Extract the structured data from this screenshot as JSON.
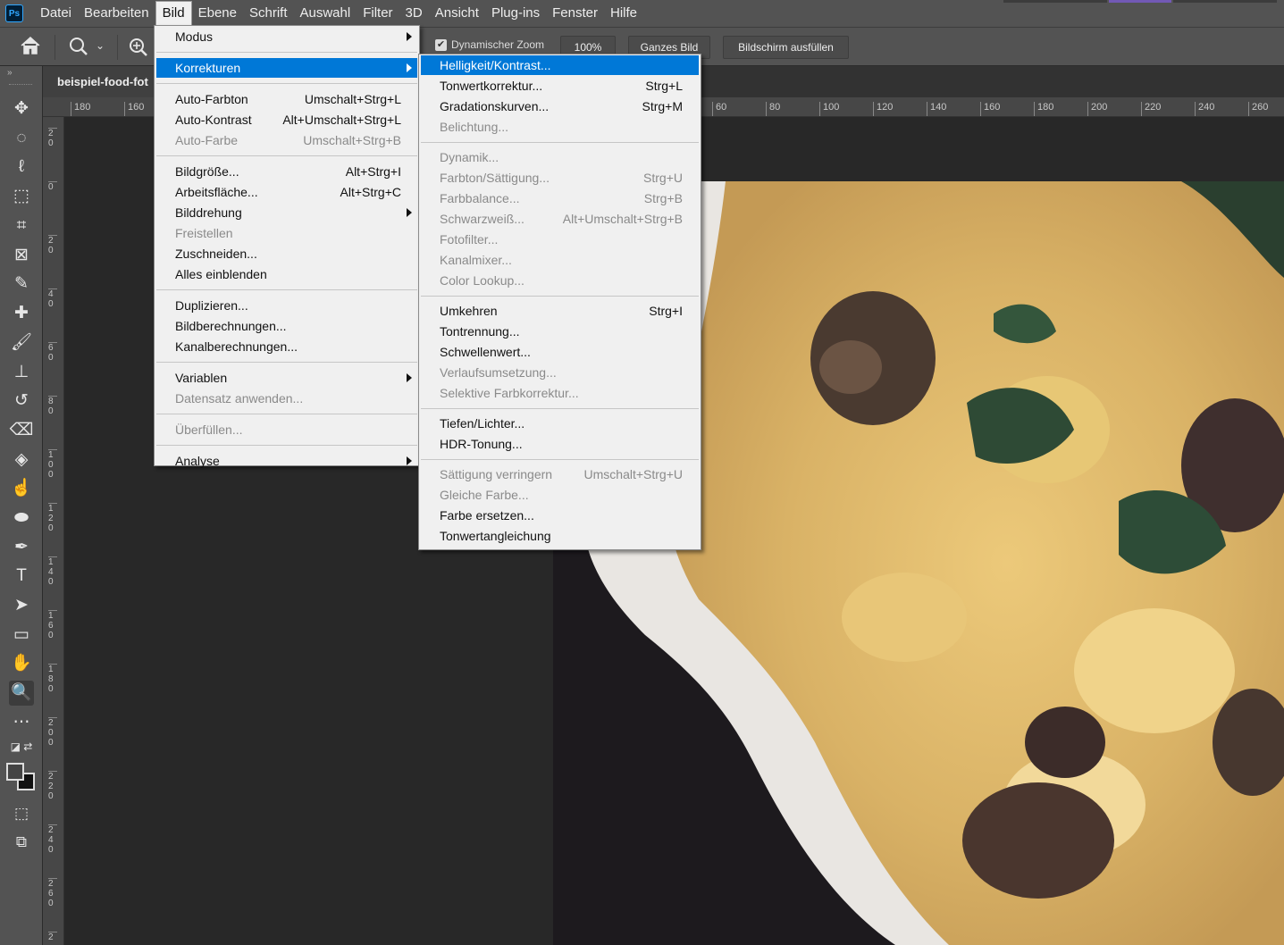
{
  "app": {
    "logo": "Ps",
    "menu": [
      "Datei",
      "Bearbeiten",
      "Bild",
      "Ebene",
      "Schrift",
      "Auswahl",
      "Filter",
      "3D",
      "Ansicht",
      "Plug-ins",
      "Fenster",
      "Hilfe"
    ],
    "active_menu": "Bild"
  },
  "options": {
    "icons": [
      "home-icon",
      "zoom-icon",
      "chevron-down-icon",
      "zoom-in-icon"
    ],
    "checkbox_label": "Dynamischer Zoom",
    "checkbox_checked": true,
    "zoom_value": "100%",
    "fit_button": "Ganzes Bild",
    "fill_button": "Bildschirm ausfüllen"
  },
  "document": {
    "tab_label": "beispiel-food-fot",
    "hruler_ticks": [
      "180",
      "160",
      "60",
      "80",
      "100",
      "120",
      "140",
      "160",
      "180",
      "200",
      "220",
      "240",
      "260"
    ],
    "vruler_ticks": [
      "20",
      "0",
      "20",
      "40",
      "60",
      "80",
      "100",
      "120",
      "140",
      "160",
      "180",
      "200",
      "220",
      "240",
      "260",
      "2"
    ]
  },
  "toolbar": {
    "tools": [
      "move-tool-icon",
      "ellipse-marquee-icon",
      "lasso-icon",
      "object-select-icon",
      "crop-icon",
      "frame-icon",
      "eyedropper-icon",
      "healing-brush-icon",
      "brush-icon",
      "stamp-icon",
      "history-brush-icon",
      "eraser-icon",
      "paint-bucket-icon",
      "smudge-icon",
      "dodge-icon",
      "pen-icon",
      "type-icon",
      "path-select-icon",
      "rectangle-icon",
      "hand-icon",
      "zoom-tool-icon",
      "more-tools-icon"
    ],
    "active_tool": "zoom-tool-icon",
    "glyphs": [
      "✥",
      "◌",
      "ℓ",
      "⬚",
      "⌗",
      "⊠",
      "✎",
      "✚",
      "🖌",
      "⊥",
      "↺",
      "⌫",
      "◈",
      "☝",
      "⬬",
      "✒",
      "T",
      "➤",
      "▭",
      "✋",
      "🔍",
      "⋯"
    ]
  },
  "bild_menu": {
    "groups": [
      [
        {
          "label": "Modus",
          "submenu": true
        }
      ],
      [
        {
          "label": "Korrekturen",
          "submenu": true,
          "highlighted": true
        }
      ],
      [
        {
          "label": "Auto-Farbton",
          "shortcut": "Umschalt+Strg+L"
        },
        {
          "label": "Auto-Kontrast",
          "shortcut": "Alt+Umschalt+Strg+L"
        },
        {
          "label": "Auto-Farbe",
          "shortcut": "Umschalt+Strg+B",
          "disabled": true
        }
      ],
      [
        {
          "label": "Bildgröße...",
          "shortcut": "Alt+Strg+I"
        },
        {
          "label": "Arbeitsfläche...",
          "shortcut": "Alt+Strg+C"
        },
        {
          "label": "Bilddrehung",
          "submenu": true
        },
        {
          "label": "Freistellen",
          "disabled": true
        },
        {
          "label": "Zuschneiden..."
        },
        {
          "label": "Alles einblenden"
        }
      ],
      [
        {
          "label": "Duplizieren..."
        },
        {
          "label": "Bildberechnungen..."
        },
        {
          "label": "Kanalberechnungen..."
        }
      ],
      [
        {
          "label": "Variablen",
          "submenu": true
        },
        {
          "label": "Datensatz anwenden...",
          "disabled": true
        }
      ],
      [
        {
          "label": "Überfüllen...",
          "disabled": true
        }
      ],
      [
        {
          "label": "Analyse",
          "submenu": true
        }
      ]
    ]
  },
  "korrekturen_menu": {
    "groups": [
      [
        {
          "label": "Helligkeit/Kontrast...",
          "highlighted": true
        },
        {
          "label": "Tonwertkorrektur...",
          "shortcut": "Strg+L"
        },
        {
          "label": "Gradationskurven...",
          "shortcut": "Strg+M"
        },
        {
          "label": "Belichtung...",
          "disabled": true
        }
      ],
      [
        {
          "label": "Dynamik...",
          "disabled": true
        },
        {
          "label": "Farbton/Sättigung...",
          "shortcut": "Strg+U",
          "disabled": true
        },
        {
          "label": "Farbbalance...",
          "shortcut": "Strg+B",
          "disabled": true
        },
        {
          "label": "Schwarzweiß...",
          "shortcut": "Alt+Umschalt+Strg+B",
          "disabled": true
        },
        {
          "label": "Fotofilter...",
          "disabled": true
        },
        {
          "label": "Kanalmixer...",
          "disabled": true
        },
        {
          "label": "Color Lookup...",
          "disabled": true
        }
      ],
      [
        {
          "label": "Umkehren",
          "shortcut": "Strg+I"
        },
        {
          "label": "Tontrennung..."
        },
        {
          "label": "Schwellenwert..."
        },
        {
          "label": "Verlaufsumsetzung...",
          "disabled": true
        },
        {
          "label": "Selektive Farbkorrektur...",
          "disabled": true
        }
      ],
      [
        {
          "label": "Tiefen/Lichter..."
        },
        {
          "label": "HDR-Tonung..."
        }
      ],
      [
        {
          "label": "Sättigung verringern",
          "shortcut": "Umschalt+Strg+U",
          "disabled": true
        },
        {
          "label": "Gleiche Farbe...",
          "disabled": true
        },
        {
          "label": "Farbe ersetzen..."
        },
        {
          "label": "Tonwertangleichung"
        }
      ]
    ]
  },
  "colors": {
    "highlight": "#0078d7",
    "menu_bg": "#f0f0f0",
    "chrome": "#535353",
    "canvas_bg": "#282828"
  }
}
